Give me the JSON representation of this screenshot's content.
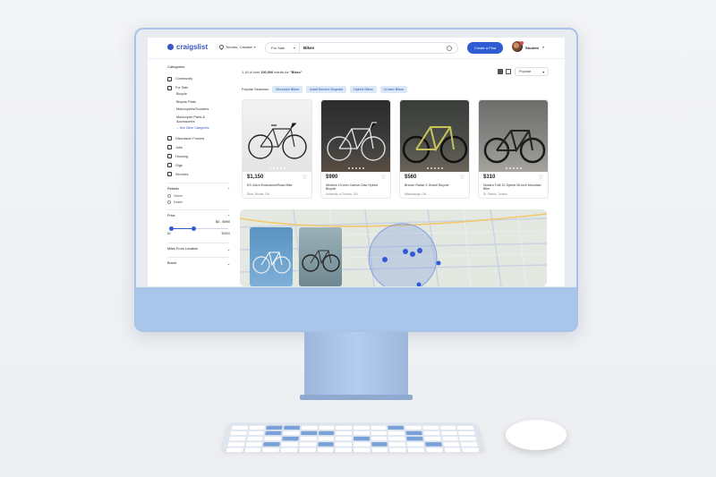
{
  "header": {
    "logo": "craigslist",
    "location": "Toronto, Canada",
    "category": "For Sale",
    "query": "Bikes",
    "post_button": "Create a Post",
    "user": "Student"
  },
  "sidebar": {
    "heading": "Categories",
    "items": [
      {
        "label": "Community"
      },
      {
        "label": "For Sale"
      }
    ],
    "for_sale_subs": [
      "Bicycle",
      "Bicycle Parts",
      "Motorcycles/Scooters",
      "Motorcycle Parts &",
      "Accessories"
    ],
    "see_other": "See Other Categories",
    "items2": [
      {
        "label": "Discussion Forums"
      },
      {
        "label": "Jobs"
      },
      {
        "label": "Housing"
      },
      {
        "label": "Gigs"
      },
      {
        "label": "Services"
      }
    ],
    "retailer": {
      "label": "Retailer",
      "options": [
        "Owner",
        "Dealer"
      ]
    },
    "price": {
      "label": "Price",
      "range": "$0 - $990",
      "min": "$0",
      "max": "$2500",
      "low_fraction": 0.0,
      "high_fraction": 0.396
    },
    "miles": "Miles From Location",
    "brand": "Brand"
  },
  "main": {
    "results_prefix": "1-16 of over ",
    "results_count": "100,000",
    "results_mid": " results for ",
    "results_query": "\"Bikes\"",
    "sort": "Popular",
    "popular_label": "Popular Searches",
    "chips": [
      "Mountain Bikes",
      "Adult Electric Bicycles",
      "Hybrid Bikes",
      "Cruiser Bikes"
    ],
    "cards": [
      {
        "price": "$1,150",
        "title": "KS 44cm Endurance/Road Bike",
        "loc": "Bloor, Bronte, ON"
      },
      {
        "price": "$990",
        "title": "Medium 19-inch Carbon Disc Hybrid Bicycle",
        "loc": "University of Toronto, ON"
      },
      {
        "price": "$560",
        "title": "Brecon Radar X Gravel Bicycle",
        "loc": "Mississauga, ON"
      },
      {
        "price": "$310",
        "title": "Novara Tutti 12-Speed 26-inch Mountain Bike",
        "loc": "St. Patrick, Toronto"
      }
    ]
  },
  "colors": {
    "accent": "#2f5bd3",
    "chip_bg": "#dbe8f8",
    "imac_blue": "#a7c4e8"
  }
}
